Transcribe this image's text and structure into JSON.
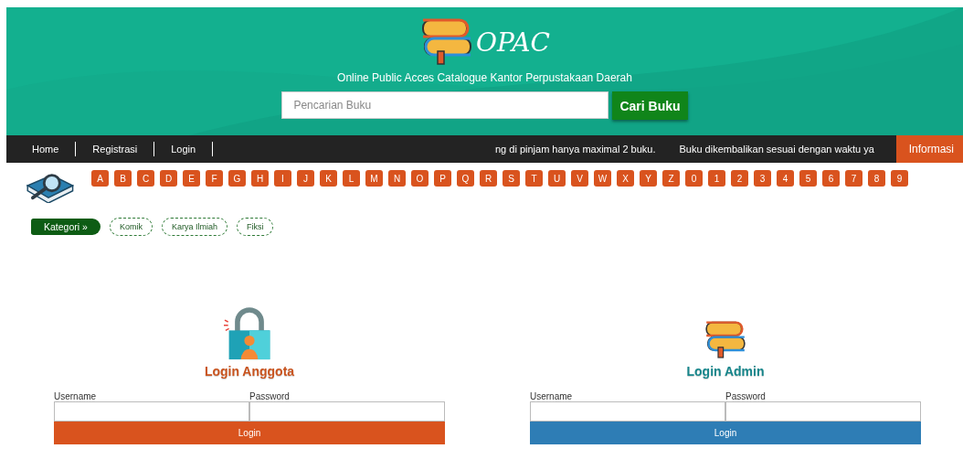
{
  "header": {
    "logo_text": "OPAC",
    "subtitle": "Online Public Acces Catalogue Kantor Perpustakaan Daerah",
    "search": {
      "placeholder": "Pencarian Buku"
    },
    "search_button": "Cari Buku"
  },
  "nav": {
    "items": [
      "Home",
      "Registrasi",
      "Login"
    ],
    "ticker": [
      "ng di pinjam hanya maximal 2 buku.",
      "Buku dikembalikan sesuai dengan waktu ya"
    ],
    "badge": "Informasi"
  },
  "alphabet": [
    "A",
    "B",
    "C",
    "D",
    "E",
    "F",
    "G",
    "H",
    "I",
    "J",
    "K",
    "L",
    "M",
    "N",
    "O",
    "P",
    "Q",
    "R",
    "S",
    "T",
    "U",
    "V",
    "W",
    "X",
    "Y",
    "Z",
    "0",
    "1",
    "2",
    "3",
    "4",
    "5",
    "6",
    "7",
    "8",
    "9"
  ],
  "categories": {
    "label": "Kategori »",
    "items": [
      "Komik",
      "Karya Ilmiah",
      "Fiksi"
    ]
  },
  "logins": [
    {
      "kind": "member",
      "title": "Login Anggota",
      "username_label": "Username",
      "password_label": "Password",
      "button": "Login"
    },
    {
      "kind": "admin",
      "title": "Login Admin",
      "username_label": "Username",
      "password_label": "Password",
      "button": "Login"
    }
  ]
}
